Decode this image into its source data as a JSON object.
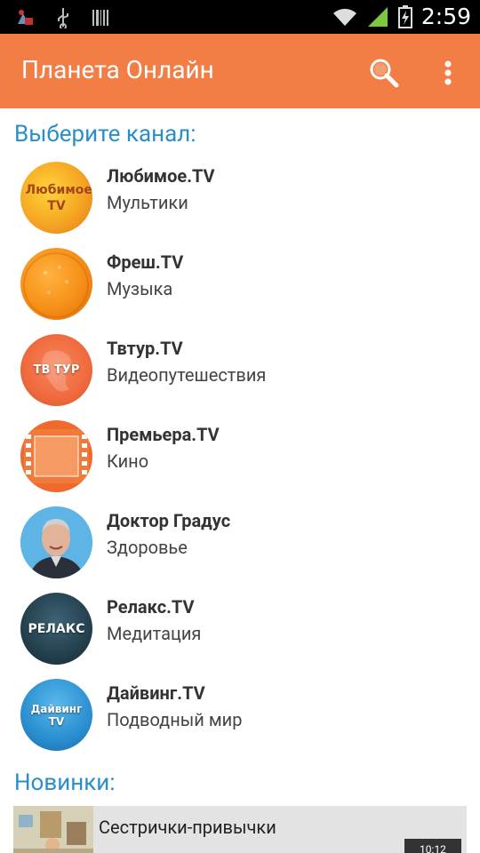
{
  "status_bar": {
    "time": "2:59",
    "left_icons": [
      "app-notification-icon",
      "usb-icon",
      "barcode-icon"
    ],
    "right_icons": [
      "wifi-icon",
      "signal-icon",
      "battery-charging-icon"
    ]
  },
  "app_bar": {
    "title": "Планета Онлайн",
    "background": "#f37e45",
    "icons": [
      "search-icon",
      "overflow-menu-icon"
    ]
  },
  "channels_heading": "Выберите канал:",
  "channels": [
    {
      "name": "Любимое.TV",
      "genre": "Мультики",
      "logo_text": "Любимое TV"
    },
    {
      "name": "Фреш.TV",
      "genre": "Музыка",
      "logo_text": ""
    },
    {
      "name": "Твтур.TV",
      "genre": "Видеопутешествия",
      "logo_text": "ТВ ТУР"
    },
    {
      "name": "Премьера.TV",
      "genre": "Кино",
      "logo_text": ""
    },
    {
      "name": "Доктор Градус",
      "genre": "Здоровье",
      "logo_text": ""
    },
    {
      "name": "Релакс.TV",
      "genre": "Медитация",
      "logo_text": "РЕЛАКС"
    },
    {
      "name": "Дайвинг.TV",
      "genre": "Подводный мир",
      "logo_text": "Дайвинг TV"
    }
  ],
  "new_heading": "Новинки:",
  "new_items": [
    {
      "title": "Сестрички-привычки",
      "duration": "10:12"
    }
  ],
  "colors": {
    "accent": "#f37e45",
    "heading": "#2a8fc9"
  }
}
